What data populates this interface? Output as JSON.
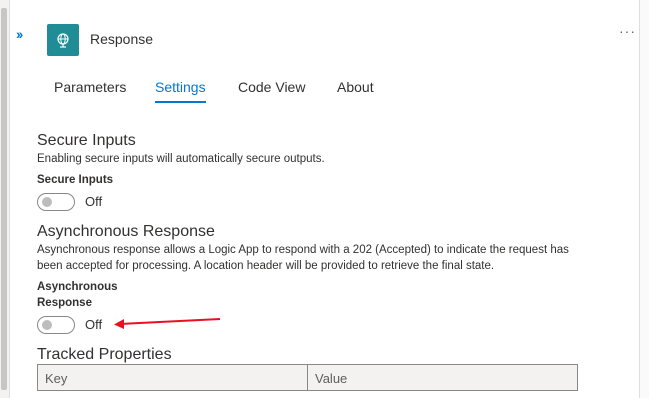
{
  "action": {
    "title": "Response",
    "icon": "globe-icon",
    "accent_color": "#1f8c96"
  },
  "tabs": [
    {
      "label": "Parameters",
      "active": false
    },
    {
      "label": "Settings",
      "active": true
    },
    {
      "label": "Code View",
      "active": false
    },
    {
      "label": "About",
      "active": false
    }
  ],
  "secure_inputs": {
    "title": "Secure Inputs",
    "description": "Enabling secure inputs will automatically secure outputs.",
    "field_label": "Secure Inputs",
    "state": "Off"
  },
  "async_response": {
    "title": "Asynchronous Response",
    "description_line1": "Asynchronous response allows a Logic App to respond with a 202 (Accepted) to indicate the request has",
    "description_line2": "been accepted for processing. A location header will be provided to retrieve the final state.",
    "field_label_line1": "Asynchronous",
    "field_label_line2": "Response",
    "state": "Off"
  },
  "tracked_properties": {
    "title": "Tracked Properties",
    "columns": [
      "Key",
      "Value"
    ]
  },
  "colors": {
    "link_blue": "#0078d4",
    "annotation_arrow": "#e81123"
  }
}
